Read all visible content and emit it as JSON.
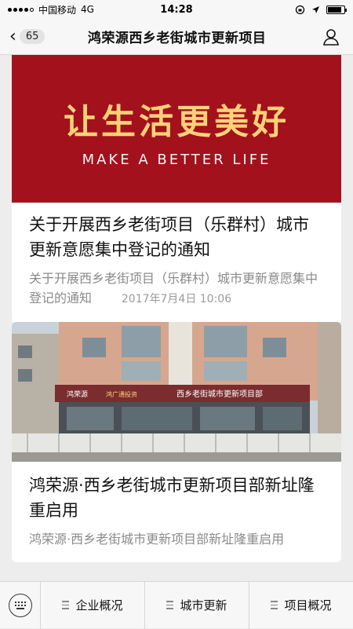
{
  "status": {
    "carrier": "中国移动",
    "network": "4G",
    "time": "14:28",
    "battery_level": 0.85
  },
  "nav": {
    "back_count": "65",
    "title": "鸿荣源西乡老街城市更新项目"
  },
  "articles": [
    {
      "banner_cn": "让生活更美好",
      "banner_en": "MAKE A BETTER LIFE",
      "title": "关于开展西乡老街项目（乐群村）城市更新意愿集中登记的通知",
      "digest": "关于开展西乡老街项目（乐群村）城市更新意愿集中登记的通知"
    },
    {
      "timestamp": "2017年7月4日 10:06",
      "photo_sign_left": "鸿荣源",
      "photo_sign_mid": "鸿广通投资",
      "photo_sign_main": "西乡老街城市更新项目部",
      "title": "鸿荣源·西乡老街城市更新项目部新址隆重启用",
      "digest": "鸿荣源·西乡老街城市更新项目部新址隆重启用"
    }
  ],
  "tabs": [
    {
      "label": "企业概况"
    },
    {
      "label": "城市更新"
    },
    {
      "label": "项目概况"
    }
  ],
  "colors": {
    "banner_red": "#a3111c",
    "banner_gold": "#ffd27a",
    "muted_text": "#8a8a8a"
  }
}
